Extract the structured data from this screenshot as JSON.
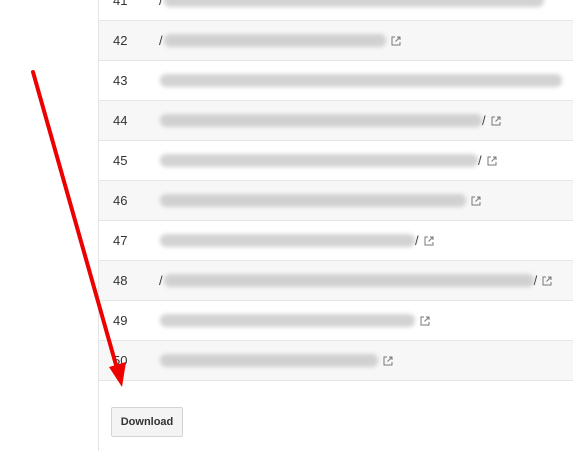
{
  "table": {
    "rows": [
      {
        "num": "41",
        "prefix": "/",
        "suffix": ""
      },
      {
        "num": "42",
        "prefix": "/",
        "suffix": ""
      },
      {
        "num": "43",
        "prefix": "",
        "suffix": ""
      },
      {
        "num": "44",
        "prefix": "",
        "suffix": "/"
      },
      {
        "num": "45",
        "prefix": "",
        "suffix": "/"
      },
      {
        "num": "46",
        "prefix": "",
        "suffix": ""
      },
      {
        "num": "47",
        "prefix": "",
        "suffix": "/"
      },
      {
        "num": "48",
        "prefix": "/",
        "suffix": "/"
      },
      {
        "num": "49",
        "prefix": "",
        "suffix": ""
      },
      {
        "num": "50",
        "prefix": "",
        "suffix": ""
      }
    ]
  },
  "download_label": "Download",
  "colors": {
    "arrow": "#ee0000",
    "row_alt": "#f7f7f7",
    "border": "#e6e6e6"
  },
  "icons": {
    "external_link": "external-link-icon"
  }
}
